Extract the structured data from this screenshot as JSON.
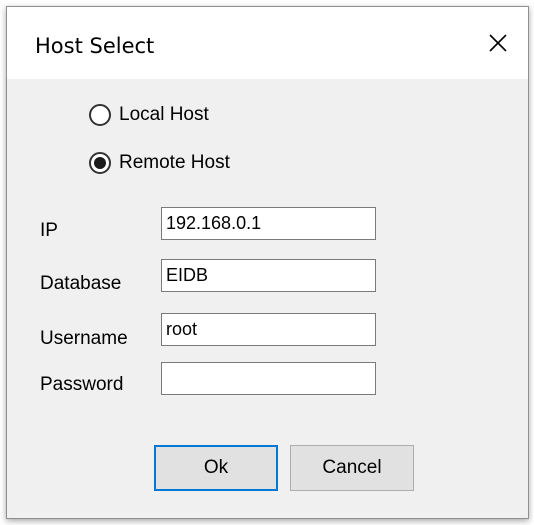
{
  "window": {
    "title": "Host Select",
    "close_icon": "close-icon"
  },
  "host_options": [
    {
      "label": "Local Host",
      "selected": false
    },
    {
      "label": "Remote Host",
      "selected": true
    }
  ],
  "fields": {
    "ip": {
      "label": "IP",
      "value": "192.168.0.1"
    },
    "database": {
      "label": "Database",
      "value": "EIDB"
    },
    "username": {
      "label": "Username",
      "value": "root"
    },
    "password": {
      "label": "Password",
      "value": ""
    }
  },
  "buttons": {
    "ok_label": "Ok",
    "cancel_label": "Cancel"
  },
  "colors": {
    "dialog_bg": "#f0f0f0",
    "focus_border": "#0078d7"
  }
}
